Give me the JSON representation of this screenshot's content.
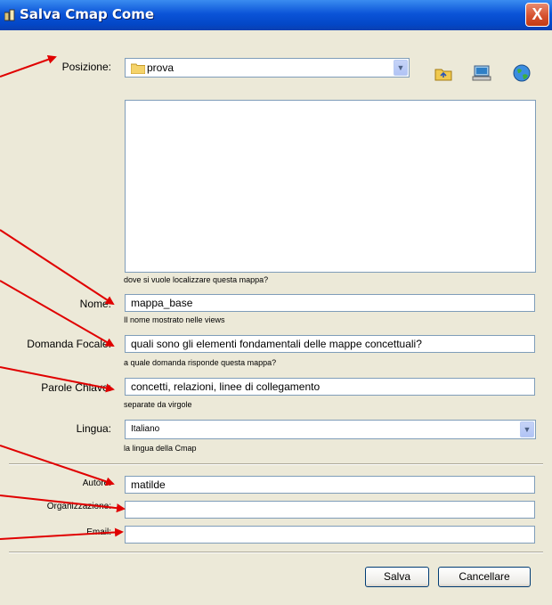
{
  "window": {
    "title": "Salva Cmap Come",
    "close_label": "X"
  },
  "location": {
    "label": "Posizione:",
    "value": "prova",
    "hint": "dove si vuole localizzare questa mappa?",
    "icons": [
      "folder-up-icon",
      "computer-icon",
      "web-places-icon"
    ]
  },
  "fields": {
    "name": {
      "label": "Nome:",
      "value": "mappa_base",
      "hint": "Il nome mostrato nelle views"
    },
    "focus_question": {
      "label": "Domanda Focale:",
      "value": "quali sono gli elementi fondamentali delle mappe concettuali?",
      "hint": "a quale domanda risponde questa mappa?"
    },
    "keywords": {
      "label": "Parole Chiave:",
      "value": "concetti, relazioni, linee di collegamento",
      "hint": "separate da virgole"
    },
    "language": {
      "label": "Lingua:",
      "value": "Italiano",
      "hint": "la lingua della Cmap"
    },
    "author": {
      "label": "Autore:",
      "value": "matilde"
    },
    "organization": {
      "label": "Organizzazione:",
      "value": ""
    },
    "email": {
      "label": "Email:",
      "value": ""
    }
  },
  "buttons": {
    "save": "Salva",
    "cancel": "Cancellare"
  },
  "colors": {
    "titlebar": "#0b54d8",
    "dialog_bg": "#ece9d8",
    "annotation_arrows": "#e00000"
  }
}
